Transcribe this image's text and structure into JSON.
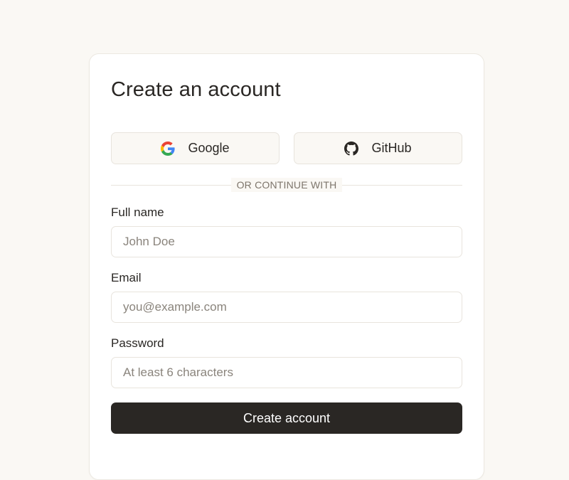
{
  "form": {
    "title": "Create an account",
    "social": {
      "google": {
        "label": "Google",
        "icon": "google-icon"
      },
      "github": {
        "label": "GitHub",
        "icon": "github-icon"
      }
    },
    "divider_text": "OR CONTINUE WITH",
    "fields": {
      "full_name": {
        "label": "Full name",
        "placeholder": "John Doe",
        "value": ""
      },
      "email": {
        "label": "Email",
        "placeholder": "you@example.com",
        "value": ""
      },
      "password": {
        "label": "Password",
        "placeholder": "At least 6 characters",
        "value": ""
      }
    },
    "submit_label": "Create account"
  },
  "colors": {
    "background": "#faf8f4",
    "card": "#ffffff",
    "text": "#2a2724",
    "muted": "#7d756b",
    "border": "#e8e4dd",
    "primary_button": "#2a2724"
  }
}
